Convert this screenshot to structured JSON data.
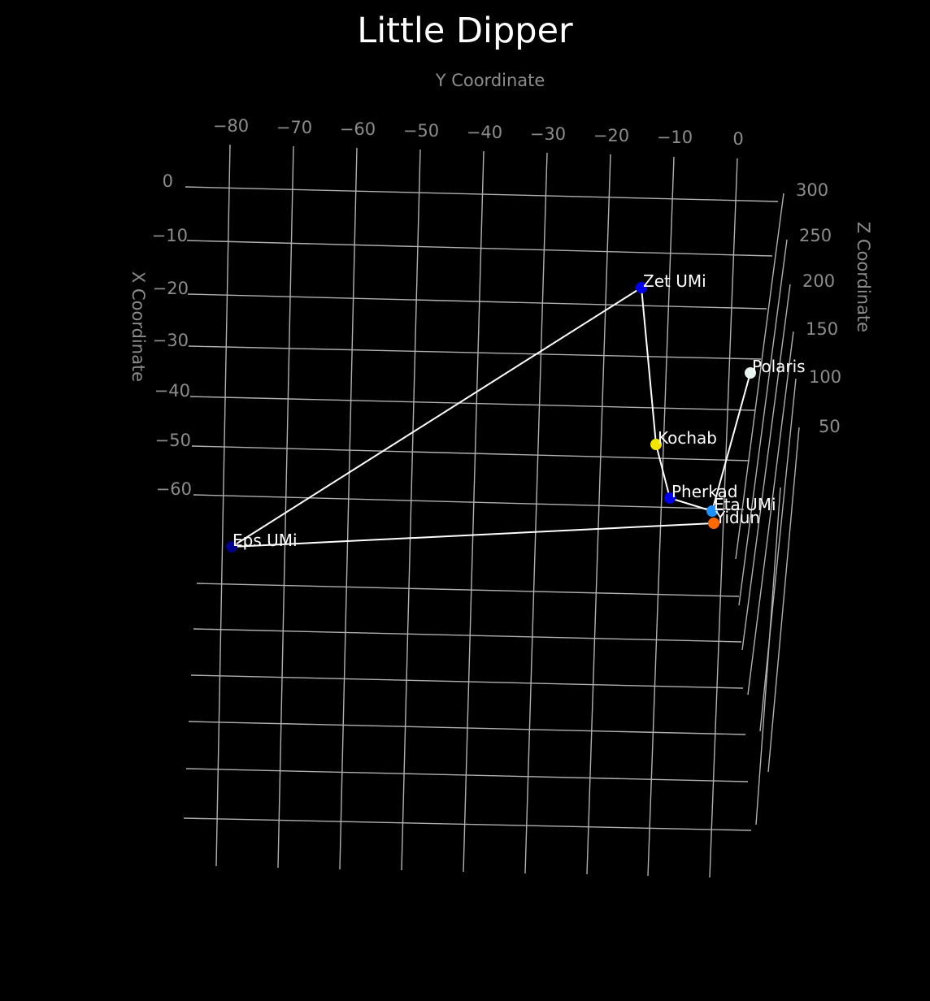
{
  "chart_data": {
    "type": "scatter",
    "projection": "3d",
    "title": "Little Dipper",
    "xlabel": "X Coordinate",
    "ylabel": "Y Coordinate",
    "zlabel": "Z Coordinate",
    "x_ticks": [
      "0",
      "−10",
      "−20",
      "−30",
      "−40",
      "−50",
      "−60"
    ],
    "y_ticks": [
      "−80",
      "−70",
      "−60",
      "−50",
      "−40",
      "−30",
      "−20",
      "−10",
      "0"
    ],
    "z_ticks": [
      "300",
      "250",
      "200",
      "150",
      "100",
      "50"
    ],
    "xlim": [
      -70,
      0
    ],
    "ylim": [
      -80,
      5
    ],
    "zlim": [
      0,
      300
    ],
    "grid": true,
    "background": "#000000",
    "stars": [
      {
        "name": "Polaris",
        "x": -35,
        "y": 2,
        "z": 133,
        "color": "#e8f4f0"
      },
      {
        "name": "Zet UMi",
        "x": -20,
        "y": -13,
        "z": 110,
        "color": "#0000ee"
      },
      {
        "name": "Kochab",
        "x": -47,
        "y": -12,
        "z": 130,
        "color": "#f2e600"
      },
      {
        "name": "Pherkad",
        "x": -60,
        "y": -9,
        "z": 80,
        "color": "#0000ee"
      },
      {
        "name": "Eta UMi",
        "x": -62,
        "y": -4,
        "z": 60,
        "color": "#1e90ff"
      },
      {
        "name": "Yidun",
        "x": -64,
        "y": -4,
        "z": 55,
        "color": "#ff6a00"
      },
      {
        "name": "Eps UMi",
        "x": -68,
        "y": -78,
        "z": 120,
        "color": "#00008b"
      }
    ],
    "lines": [
      [
        "Polaris",
        "Eta UMi"
      ],
      [
        "Eta UMi",
        "Pherkad"
      ],
      [
        "Pherkad",
        "Kochab"
      ],
      [
        "Kochab",
        "Zet UMi"
      ],
      [
        "Zet UMi",
        "Eps UMi"
      ],
      [
        "Eps UMi",
        "Yidun"
      ]
    ],
    "line_color": "#ffffff"
  }
}
